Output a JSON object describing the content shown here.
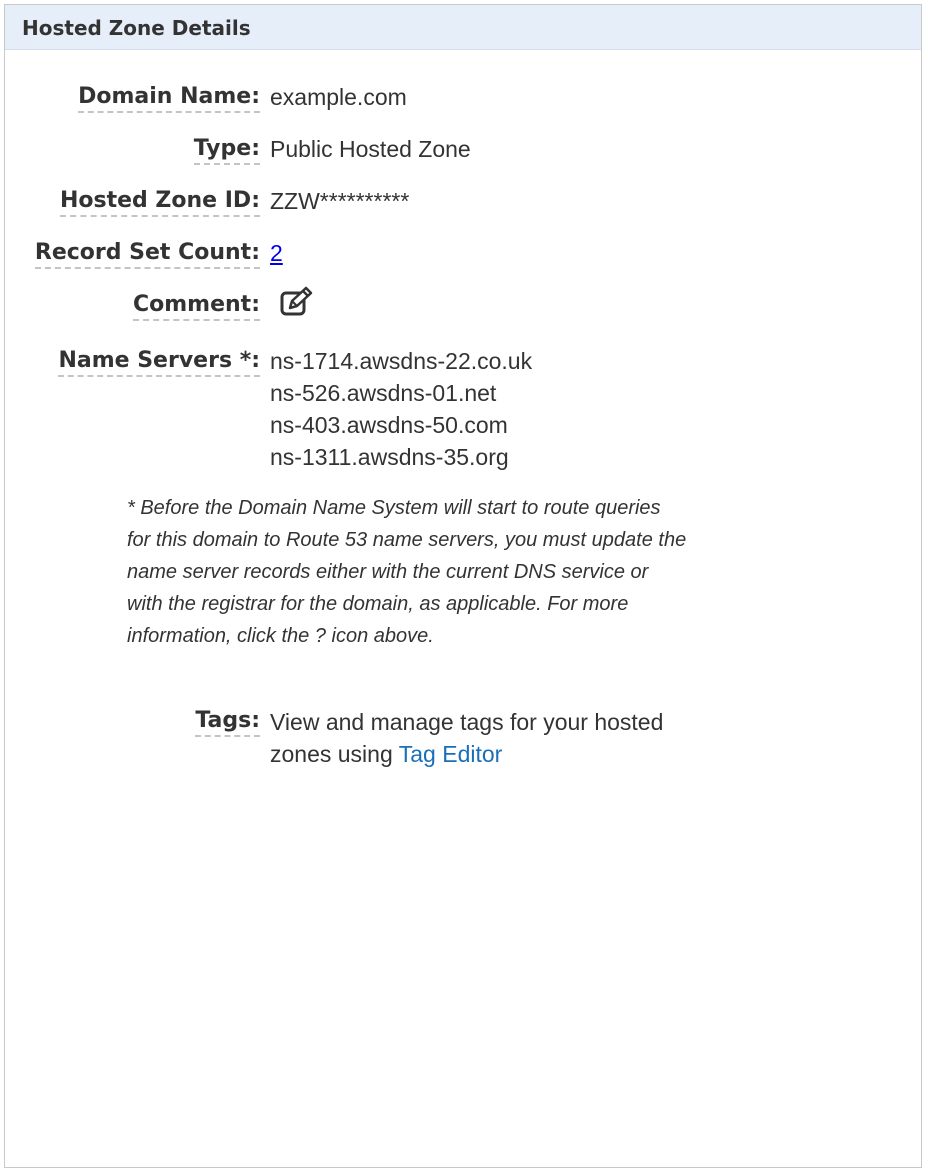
{
  "panel": {
    "title": "Hosted Zone Details"
  },
  "fields": {
    "domain_name": {
      "label": "Domain Name:",
      "value": "example.com"
    },
    "type": {
      "label": "Type:",
      "value": "Public Hosted Zone"
    },
    "hosted_zone_id": {
      "label": "Hosted Zone ID:",
      "value": "ZZW**********"
    },
    "record_set_count": {
      "label": "Record Set Count:",
      "value": "2"
    },
    "comment": {
      "label": "Comment:",
      "icon": "edit-icon"
    },
    "name_servers": {
      "label": "Name Servers *:",
      "values": [
        "ns-1714.awsdns-22.co.uk",
        "ns-526.awsdns-01.net",
        "ns-403.awsdns-50.com",
        "ns-1311.awsdns-35.org"
      ]
    },
    "tags": {
      "label": "Tags:",
      "text": "View and manage tags for your hosted zones using",
      "link": "Tag Editor"
    }
  },
  "name_servers_note": "* Before the Domain Name System will start to route queries for this domain to Route 53 name servers, you must update the name server records either with the current DNS service or with the registrar for the domain, as applicable. For more information, click the ? icon above.",
  "colors": {
    "header_bg": "#e6eefa",
    "text": "#333333",
    "link": "#0000ee",
    "tag_editor_link": "#1a6fb8"
  }
}
